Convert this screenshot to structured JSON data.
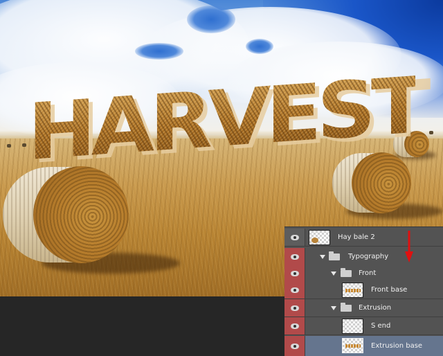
{
  "artwork": {
    "headline": "HARVEST"
  },
  "layers_panel": {
    "layers": [
      {
        "label": "Hay bale 2",
        "type": "layer",
        "thumb": "hay-bale-thumbnail",
        "visible": true
      },
      {
        "label": "Typography",
        "type": "group",
        "expanded": true,
        "visible": true
      },
      {
        "label": "Front",
        "type": "group",
        "expanded": true,
        "visible": true
      },
      {
        "label": "Front base",
        "type": "layer",
        "thumb": "text-thumbnail",
        "visible": true
      },
      {
        "label": "Extrusion",
        "type": "group",
        "expanded": true,
        "visible": true
      },
      {
        "label": "S end",
        "type": "layer",
        "thumb": "transparent-thumbnail",
        "visible": true
      },
      {
        "label": "Extrusion base",
        "type": "layer",
        "thumb": "text-thumbnail",
        "visible": true,
        "selected": true
      }
    ]
  },
  "colors": {
    "panel_bg": "#535353",
    "selected_row": "#65758e",
    "visibility_cell": "#b14a4a",
    "annotation_arrow": "#e01010"
  },
  "icons": [
    "eye-icon",
    "folder-icon",
    "disclosure-triangle-icon",
    "red-arrow-icon"
  ]
}
